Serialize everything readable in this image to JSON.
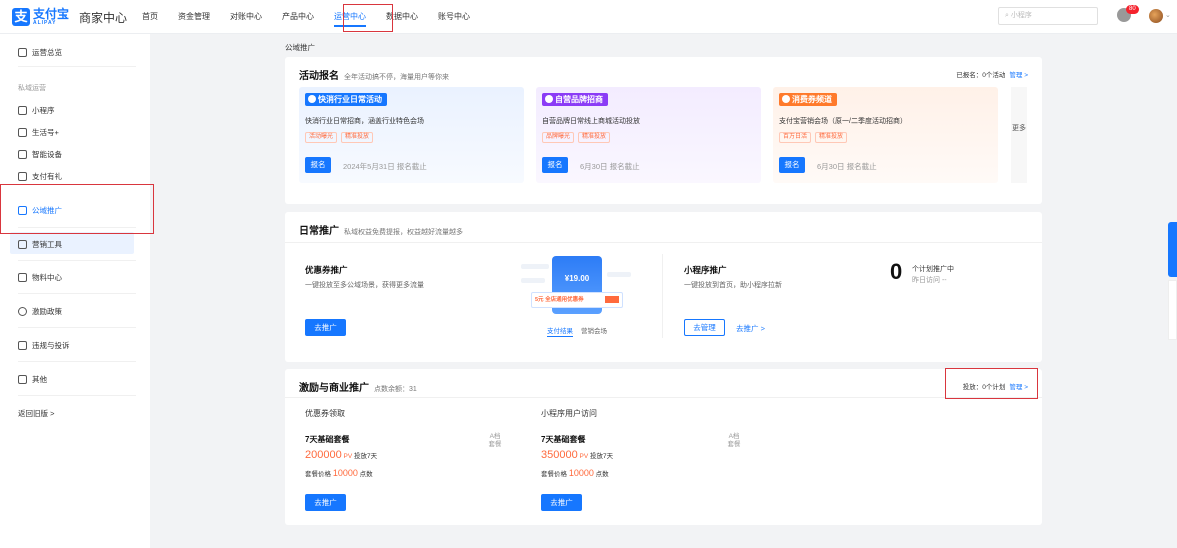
{
  "brand": {
    "logo_mark": "支",
    "logo_text": "支付宝",
    "logo_subtext": "ALIPAY",
    "title": "商家中心"
  },
  "topnav": [
    {
      "label": "首页"
    },
    {
      "label": "资金管理"
    },
    {
      "label": "对账中心"
    },
    {
      "label": "产品中心"
    },
    {
      "label": "运营中心",
      "active": true
    },
    {
      "label": "数据中心"
    },
    {
      "label": "账号中心"
    }
  ],
  "header": {
    "search_placeholder": "小程序",
    "notification_count": "80",
    "icons": [
      "search-icon",
      "bell-icon",
      "avatar",
      "chevron-down-icon"
    ]
  },
  "sidebar": {
    "overview": "运营总览",
    "group_private": "私域运营",
    "items": [
      "小程序",
      "生活号+",
      "智能设备",
      "支付有礼",
      "公域推广",
      "营销工具",
      "物料中心",
      "激励政策",
      "违规与投诉",
      "其他"
    ],
    "back": "返回旧版 >"
  },
  "breadcrumb": "公域推广",
  "activity": {
    "title": "活动报名",
    "subtitle": "全年活动搞不停，海量用户等你来",
    "registered": "已报名：0个活动",
    "manage": "管理 >",
    "more": "更多",
    "cards": [
      {
        "tag": "快消行业日常活动",
        "desc": "快消行业日常招商，涵盖行业特色会场",
        "chips": [
          "活动曝光",
          "精准投放"
        ],
        "button": "报名",
        "deadline": "2024年5月31日 报名截止"
      },
      {
        "tag": "自营品牌招商",
        "desc": "自营品牌日常线上商城活动投放",
        "chips": [
          "品牌曝光",
          "精准投放"
        ],
        "button": "报名",
        "deadline": "6月30日 报名截止"
      },
      {
        "tag": "消费券频道",
        "desc": "支付宝营销会场（原一/二季度活动招商）",
        "chips": [
          "百万日活",
          "精准投放"
        ],
        "button": "报名",
        "deadline": "6月30日 报名截止"
      }
    ],
    "colors": {
      "card1": "#1677ff",
      "card2": "#8b3cf6",
      "card3": "#ff7a2b"
    }
  },
  "daily": {
    "title": "日常推广",
    "subtitle": "私域权益免费提报，权益越好流量越多",
    "coupon": {
      "title": "优惠券推广",
      "desc": "一键投放至多公域场景，获得更多流量",
      "button": "去推广",
      "preview_amount": "¥19.00",
      "preview_coupon": "5元 全店通用优惠券",
      "tabs": [
        "支付结果",
        "营销会场"
      ]
    },
    "miniapp": {
      "title": "小程序推广",
      "desc": "一键投放到首页，助小程序拉新",
      "manage_button": "去管理",
      "promote_link": "去推广 >"
    },
    "stat": {
      "value": "0",
      "label": "个计划推广中",
      "sub": "昨日访问 --"
    }
  },
  "incentive": {
    "title": "激励与商业推广",
    "subtitle": "点数余额：31",
    "plans": "投放：0个计划",
    "manage": "管理 >",
    "columns": [
      {
        "head": "优惠券领取",
        "name": "7天基础套餐",
        "tier": "A档 套餐",
        "pv": "200000",
        "pv_unit": "PV",
        "pv_suffix": "投放7天",
        "price_label": "套餐价格",
        "price": "10000",
        "price_unit": "点数",
        "button": "去推广"
      },
      {
        "head": "小程序用户访问",
        "name": "7天基础套餐",
        "tier": "A档 套餐",
        "pv": "350000",
        "pv_unit": "PV",
        "pv_suffix": "投放7天",
        "price_label": "套餐价格",
        "price": "10000",
        "price_unit": "点数",
        "button": "去推广"
      }
    ]
  }
}
